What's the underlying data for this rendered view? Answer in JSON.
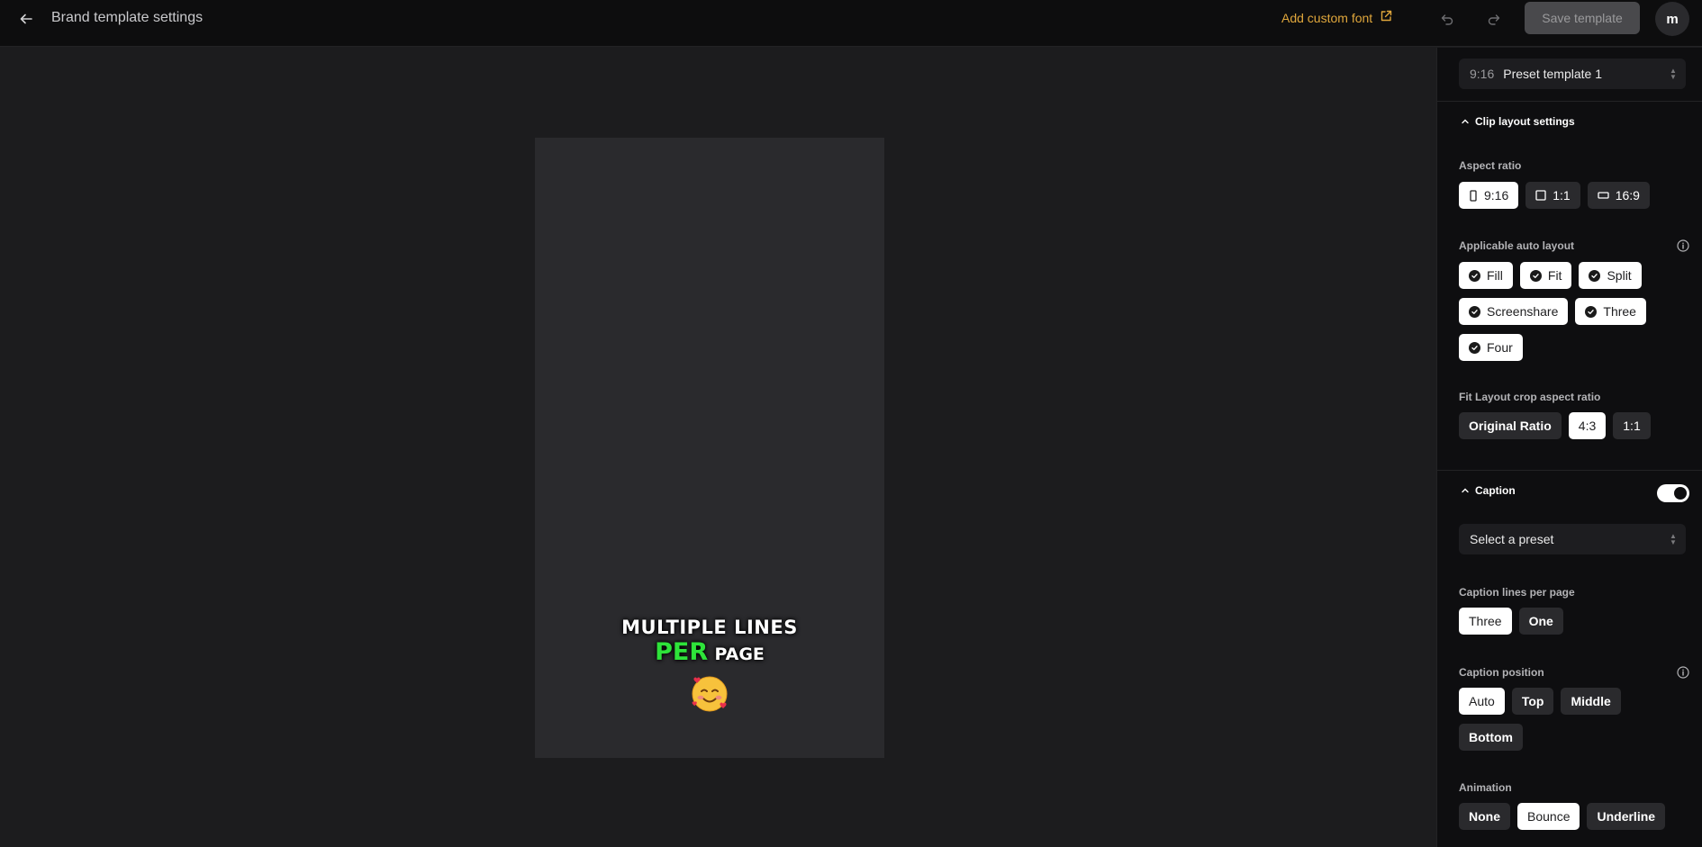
{
  "header": {
    "title": "Brand template settings",
    "add_font_label": "Add custom font",
    "save_label": "Save template",
    "avatar_initial": "m"
  },
  "preview": {
    "caption_line1": "MULTIPLE LINES",
    "caption_highlight": "PER",
    "caption_rest": "PAGE",
    "highlight_color": "#2ee33a"
  },
  "panel": {
    "template_select": {
      "ratio": "9:16",
      "name": "Preset template 1"
    },
    "clip_layout": {
      "title": "Clip layout settings",
      "aspect_ratio_label": "Aspect ratio",
      "aspect_ratios": [
        {
          "label": "9:16",
          "selected": true
        },
        {
          "label": "1:1",
          "selected": false
        },
        {
          "label": "16:9",
          "selected": false
        }
      ],
      "auto_layout_label": "Applicable auto layout",
      "auto_layouts": [
        "Fill",
        "Fit",
        "Split",
        "Screenshare",
        "Three",
        "Four"
      ],
      "fit_crop_label": "Fit Layout crop aspect ratio",
      "fit_crop_options": [
        {
          "label": "Original Ratio",
          "selected": false
        },
        {
          "label": "4:3",
          "selected": true
        },
        {
          "label": "1:1",
          "selected": false
        }
      ]
    },
    "caption": {
      "title": "Caption",
      "enabled": true,
      "preset_placeholder": "Select a preset",
      "lines_label": "Caption lines per page",
      "lines_options": [
        {
          "label": "Three",
          "selected": true
        },
        {
          "label": "One",
          "selected": false
        }
      ],
      "position_label": "Caption position",
      "position_options": [
        {
          "label": "Auto",
          "selected": true
        },
        {
          "label": "Top",
          "selected": false
        },
        {
          "label": "Middle",
          "selected": false
        },
        {
          "label": "Bottom",
          "selected": false
        }
      ],
      "animation_label": "Animation",
      "animation_options": [
        {
          "label": "None",
          "selected": false
        },
        {
          "label": "Bounce",
          "selected": true
        },
        {
          "label": "Underline",
          "selected": false
        }
      ]
    }
  }
}
